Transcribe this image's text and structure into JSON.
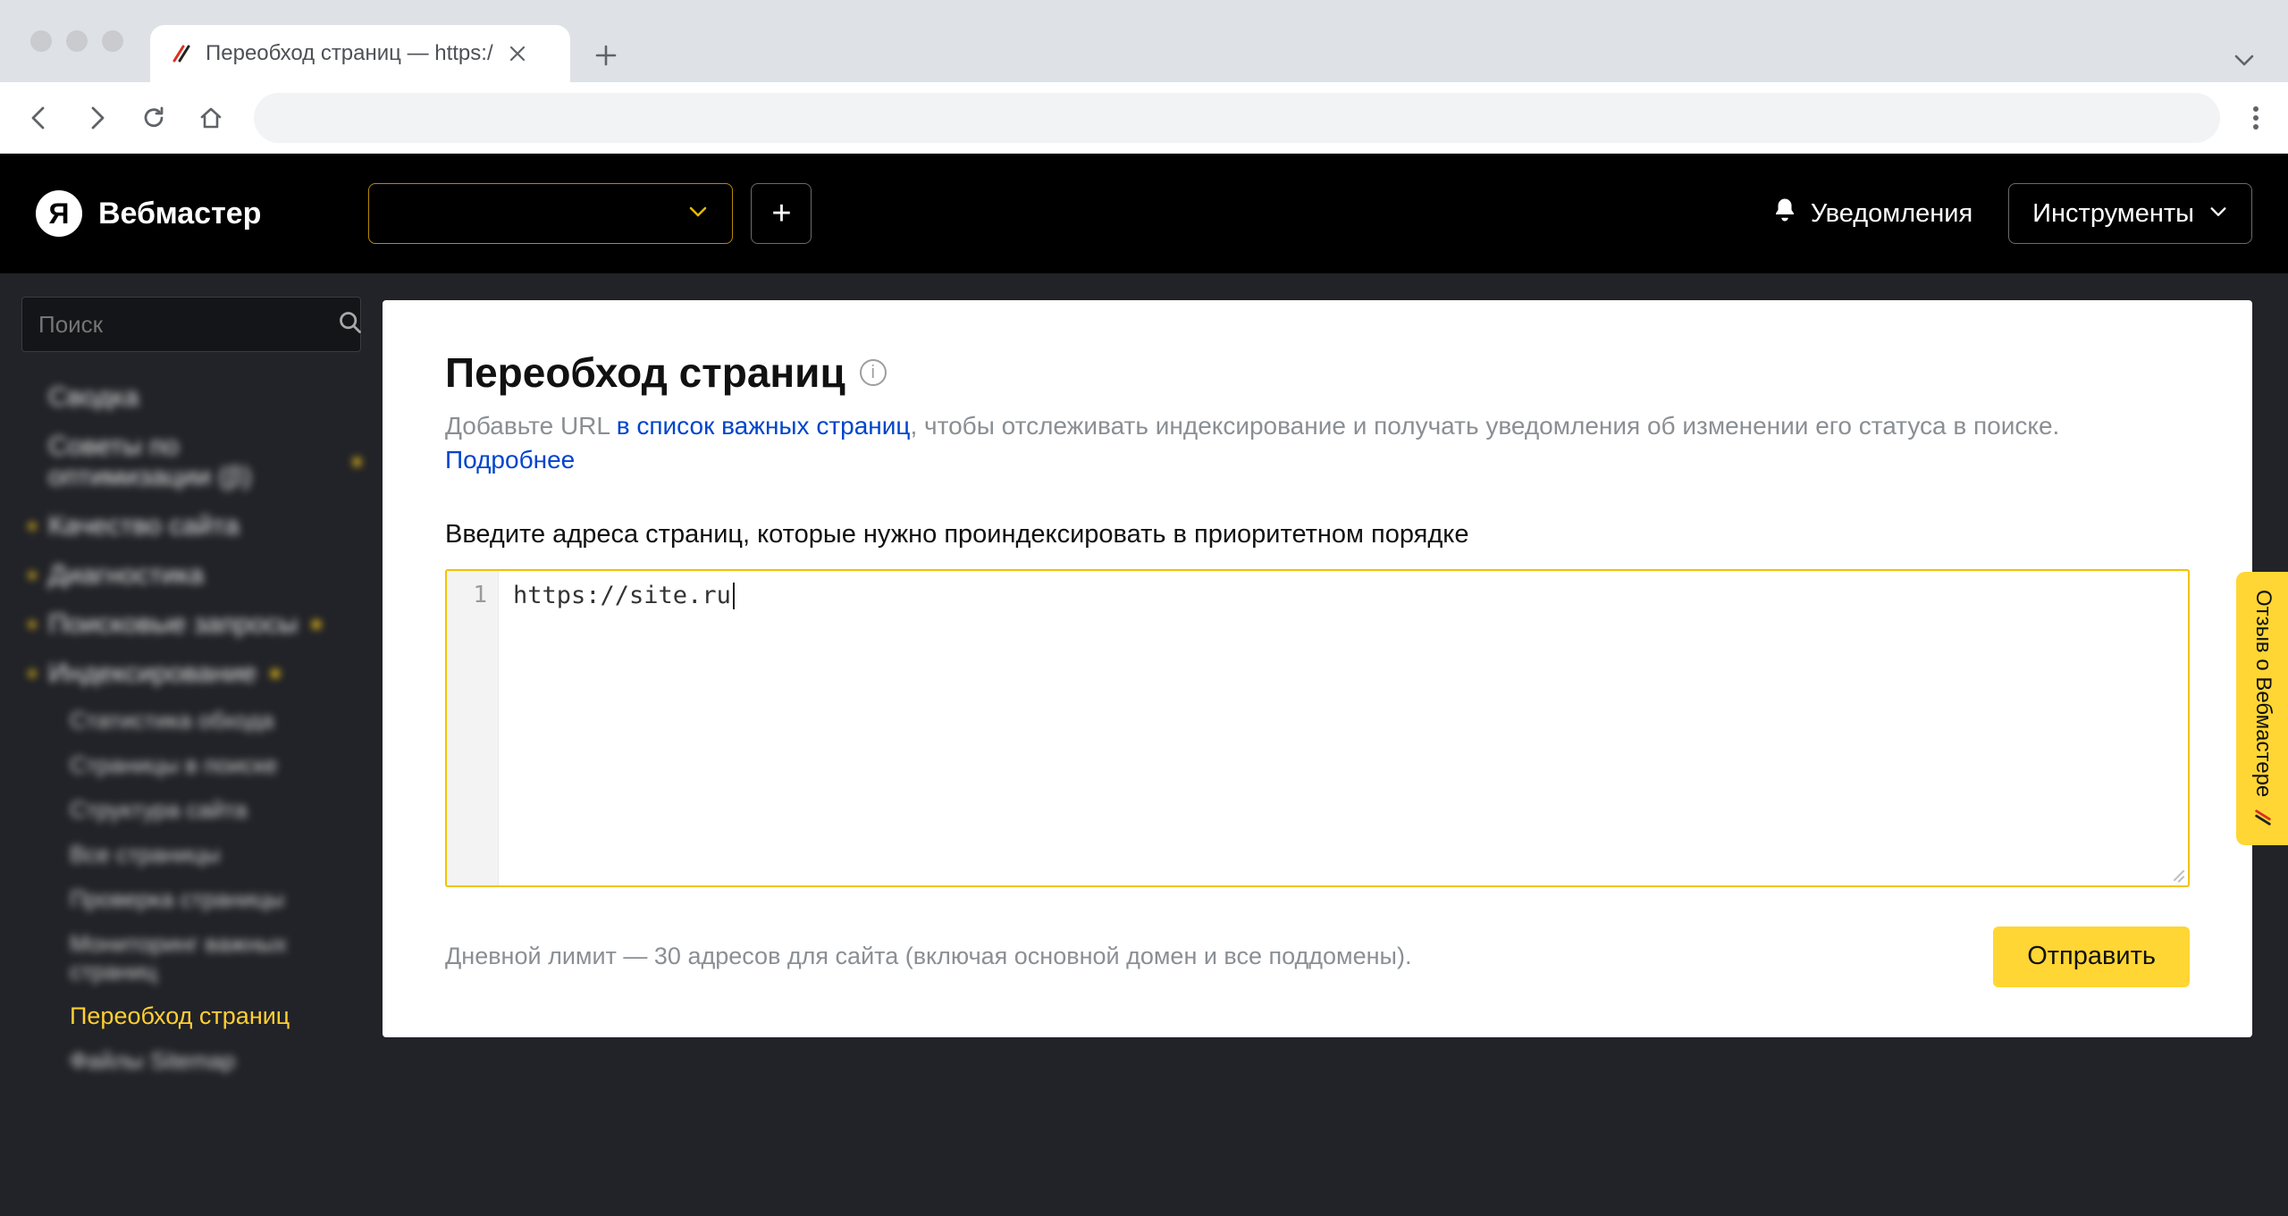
{
  "browser": {
    "tab_title": "Переобход страниц — https:/",
    "traffic_light_count": 3
  },
  "header": {
    "brand": "Вебмастер",
    "logo_letter": "Я",
    "notifications_label": "Уведомления",
    "tools_label": "Инструменты",
    "add_button_glyph": "+"
  },
  "sidebar": {
    "search_placeholder": "Поиск",
    "items": [
      {
        "label": "Сводка",
        "left_bullet": false,
        "trail_dot": false
      },
      {
        "label": "Советы по оптимизации (β)",
        "left_bullet": false,
        "trail_dot": true
      },
      {
        "label": "Качество сайта",
        "left_bullet": true,
        "trail_dot": false
      },
      {
        "label": "Диагностика",
        "left_bullet": true,
        "trail_dot": false
      },
      {
        "label": "Поисковые запросы",
        "left_bullet": true,
        "trail_dot": true
      },
      {
        "label": "Индексирование",
        "left_bullet": true,
        "trail_dot": true
      }
    ],
    "sub_items": [
      "Статистика обхода",
      "Страницы в поиске",
      "Структура сайта",
      "Все страницы",
      "Проверка страницы",
      "Мониторинг важных страниц",
      "Переобход страниц",
      "Файлы Sitemap"
    ],
    "active_sub_index": 6
  },
  "main": {
    "title": "Переобход страниц",
    "subtitle_prefix": "Добавьте URL ",
    "subtitle_link1": "в список важных страниц",
    "subtitle_middle": ", чтобы отслеживать индексирование и получать уведомления об изменении его статуса в поиске. ",
    "subtitle_link2": "Подробнее",
    "field_label": "Введите адреса страниц, которые нужно проиндексировать в приоритетном порядке",
    "line_number": "1",
    "code_value": "https://site.ru",
    "limit_text": "Дневной лимит — 30 адресов для сайта (включая основной домен и все поддомены).",
    "send_label": "Отправить"
  },
  "feedback": {
    "label": "Отзыв о Вебмастере"
  }
}
